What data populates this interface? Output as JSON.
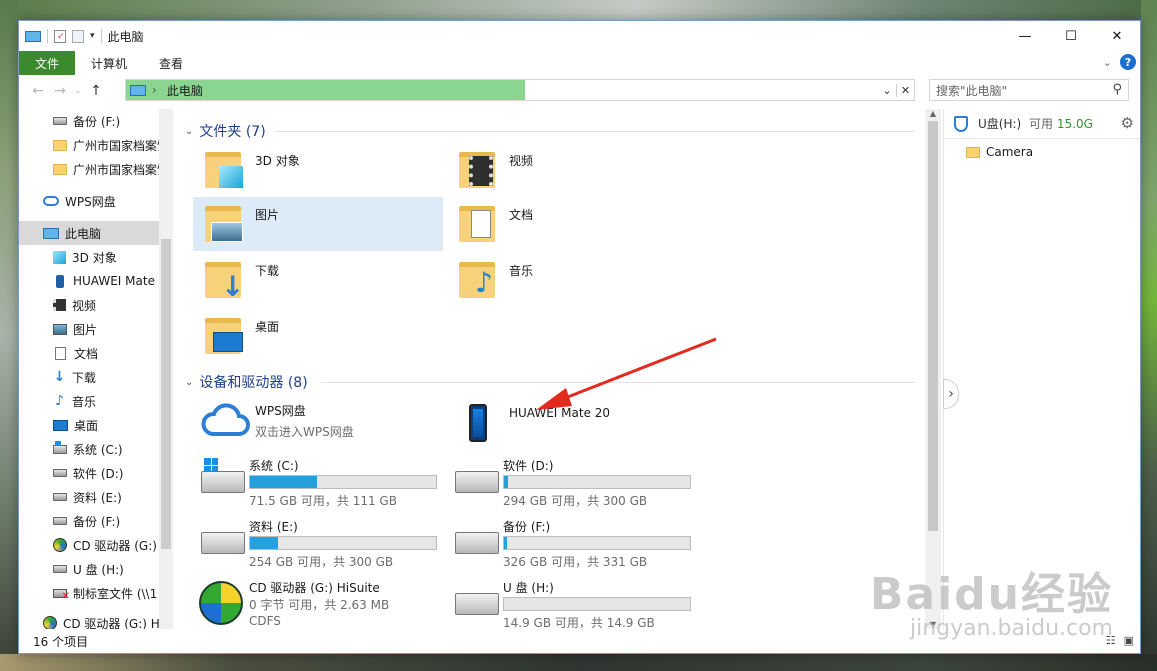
{
  "window": {
    "title": "此电脑"
  },
  "ribbon": {
    "file": "文件",
    "computer": "计算机",
    "view": "查看"
  },
  "address": {
    "path": "此电脑"
  },
  "search": {
    "placeholder": "搜索\"此电脑\""
  },
  "nav": {
    "items": [
      {
        "label": "备份 (F:)"
      },
      {
        "label": "广州市国家档案馆"
      },
      {
        "label": "广州市国家档案馆"
      },
      {
        "label": "WPS网盘"
      },
      {
        "label": "此电脑"
      },
      {
        "label": "3D 对象"
      },
      {
        "label": "HUAWEI Mate"
      },
      {
        "label": "视频"
      },
      {
        "label": "图片"
      },
      {
        "label": "文档"
      },
      {
        "label": "下载"
      },
      {
        "label": "音乐"
      },
      {
        "label": "桌面"
      },
      {
        "label": "系统 (C:)"
      },
      {
        "label": "软件 (D:)"
      },
      {
        "label": "资料 (E:)"
      },
      {
        "label": "备份 (F:)"
      },
      {
        "label": "CD 驱动器 (G:)"
      },
      {
        "label": "U 盘 (H:)"
      },
      {
        "label": "制标室文件 (\\\\1"
      },
      {
        "label": "CD 驱动器 (G:) H"
      }
    ]
  },
  "folders": {
    "heading": "文件夹 (7)",
    "items": [
      {
        "label": "3D 对象"
      },
      {
        "label": "视频"
      },
      {
        "label": "图片"
      },
      {
        "label": "文档"
      },
      {
        "label": "下载"
      },
      {
        "label": "音乐"
      },
      {
        "label": "桌面"
      }
    ]
  },
  "devices": {
    "heading": "设备和驱动器 (8)",
    "wps": {
      "name": "WPS网盘",
      "sub": "双击进入WPS网盘"
    },
    "phone": {
      "name": "HUAWEI Mate 20"
    },
    "drives": [
      {
        "name": "系统 (C:)",
        "free": "71.5 GB 可用，共 111 GB",
        "used_fraction": 0.36
      },
      {
        "name": "软件 (D:)",
        "free": "294 GB 可用，共 300 GB",
        "used_fraction": 0.02
      },
      {
        "name": "资料 (E:)",
        "free": "254 GB 可用，共 300 GB",
        "used_fraction": 0.15
      },
      {
        "name": "备份 (F:)",
        "free": "326 GB 可用，共 331 GB",
        "used_fraction": 0.015
      },
      {
        "name": "U 盘 (H:)",
        "free": "14.9 GB 可用，共 14.9 GB",
        "used_fraction": 0.0
      }
    ],
    "cd": {
      "name": "CD 驱动器 (G:) HiSuite",
      "free": "0 字节 可用，共 2.63 MB",
      "fs": "CDFS"
    }
  },
  "preview": {
    "drive": "U盘(H:)",
    "free_label": "可用",
    "free_value": "15.0G",
    "folder": "Camera"
  },
  "status": {
    "count": "16 个项目"
  },
  "watermark": {
    "brand": "Baidu经验",
    "url": "jingyan.baidu.com"
  },
  "colors": {
    "accent": "#3b8a2e",
    "address_fill": "#8ad58f",
    "bar_fill": "#26a0da",
    "arrow": "#e32a1f"
  }
}
